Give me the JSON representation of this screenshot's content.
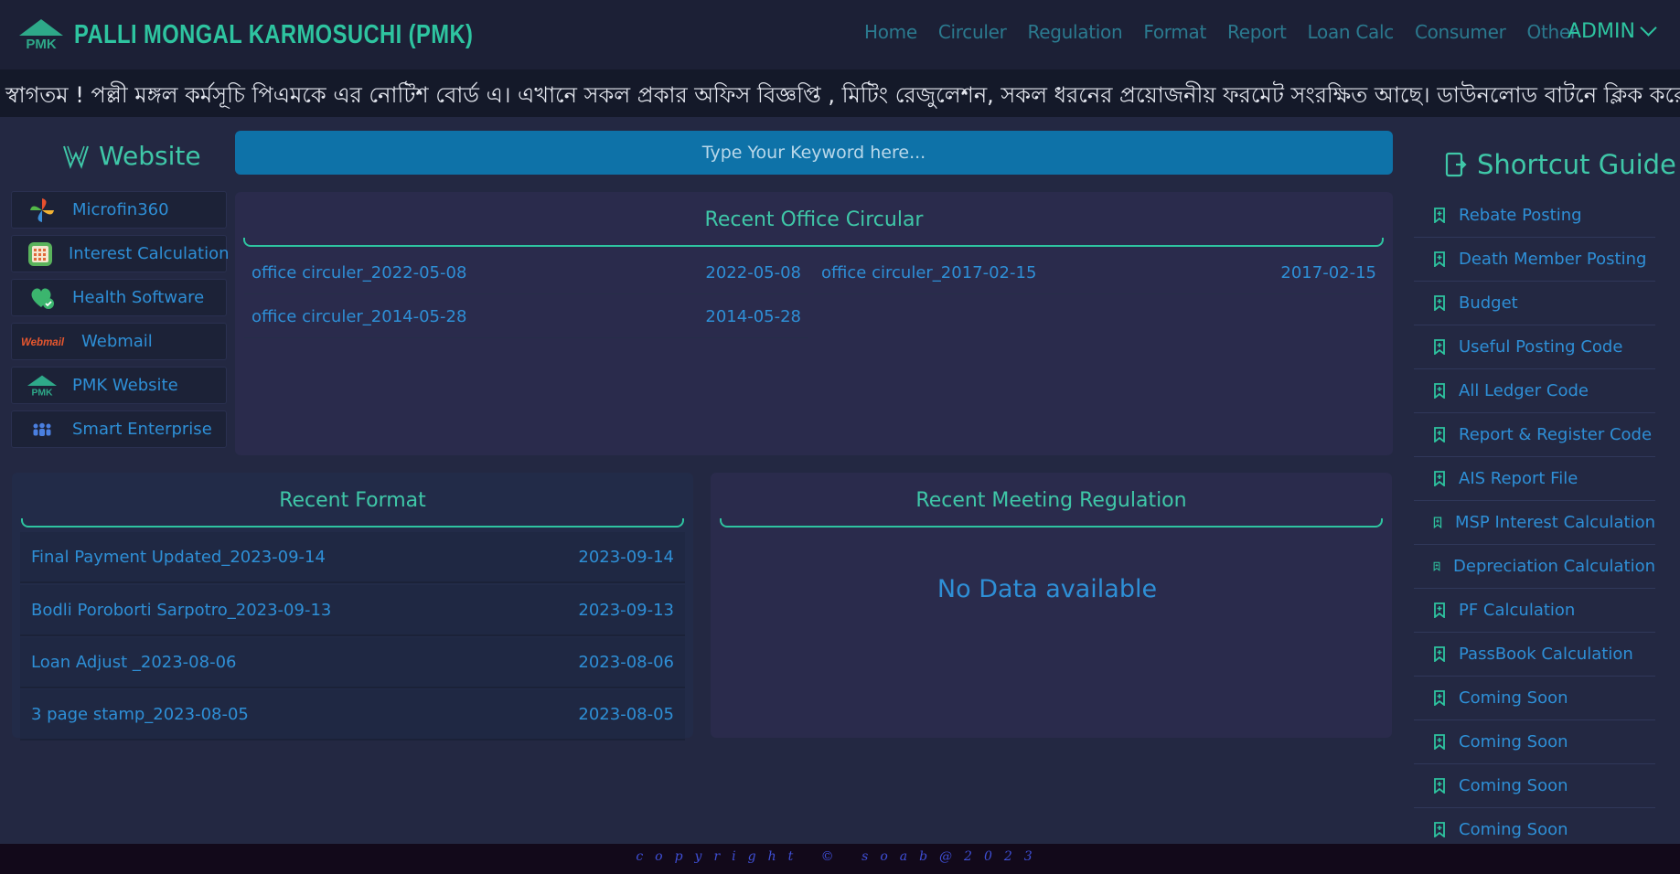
{
  "brand": {
    "logo_text": "PMK",
    "title": "PALLI MONGAL KARMOSUCHI (PMK)"
  },
  "nav": [
    "Home",
    "Circuler",
    "Regulation",
    "Format",
    "Report",
    "Loan Calc",
    "Consumer",
    "Other"
  ],
  "admin": "ADMIN",
  "marquee": "স্বাগতম ! পল্লী মঙ্গল কর্মসূচি পিএমকে এর নোটিশ বোর্ড এ। এখানে সকল প্রকার অফিস বিজ্ঞপ্তি , মিটিং রেজুলেশন, সকল ধরনের প্রয়োজনীয় ফরমেট সংরক্ষিত আছে। ডাউনলোড বাটনে ক্লিক করে আপনার প্রয়োজনীয় ফাইল ডাউনলোড করুন।",
  "website": {
    "title": "Website",
    "items": [
      {
        "label": "Microfin360",
        "icon": "pinwheel-icon"
      },
      {
        "label": "Interest Calculation",
        "icon": "calculator-icon"
      },
      {
        "label": "Health Software",
        "icon": "heart-check-icon"
      },
      {
        "label": "Webmail",
        "icon": "webmail-logo-icon",
        "logo_text": "Webmail"
      },
      {
        "label": "PMK Website",
        "icon": "pmk-logo-icon",
        "logo_text": "PMK"
      },
      {
        "label": "Smart Enterprise",
        "icon": "people-icon"
      }
    ]
  },
  "search": {
    "placeholder": "Type Your Keyword here..."
  },
  "circular": {
    "title": "Recent Office Circular",
    "items": [
      {
        "name": "office circuler_2022-05-08",
        "date": "2022-05-08"
      },
      {
        "name": "office circuler_2017-02-15",
        "date": "2017-02-15"
      },
      {
        "name": "office circuler_2014-05-28",
        "date": "2014-05-28"
      }
    ]
  },
  "format": {
    "title": "Recent Format",
    "items": [
      {
        "name": "Final Payment Updated_2023-09-14",
        "date": "2023-09-14"
      },
      {
        "name": "Bodli Poroborti Sarpotro_2023-09-13",
        "date": "2023-09-13"
      },
      {
        "name": "Loan Adjust _2023-08-06",
        "date": "2023-08-06"
      },
      {
        "name": "3 page stamp_2023-08-05",
        "date": "2023-08-05"
      }
    ]
  },
  "meeting": {
    "title": "Recent Meeting Regulation",
    "empty": "No Data available"
  },
  "shortcut": {
    "title": "Shortcut Guide",
    "items": [
      "Rebate Posting",
      "Death Member Posting",
      "Budget",
      "Useful Posting Code",
      "All Ledger Code",
      "Report & Register Code",
      "AIS Report File",
      "MSP Interest Calculation",
      "Depreciation Calculation",
      "PF Calculation",
      "PassBook Calculation",
      "Coming Soon",
      "Coming Soon",
      "Coming Soon",
      "Coming Soon"
    ]
  },
  "footer": "copyright © soab@2023",
  "colors": {
    "accent": "#2ec4a0",
    "link": "#2e8fd6",
    "search_bg": "#0e72a8"
  }
}
